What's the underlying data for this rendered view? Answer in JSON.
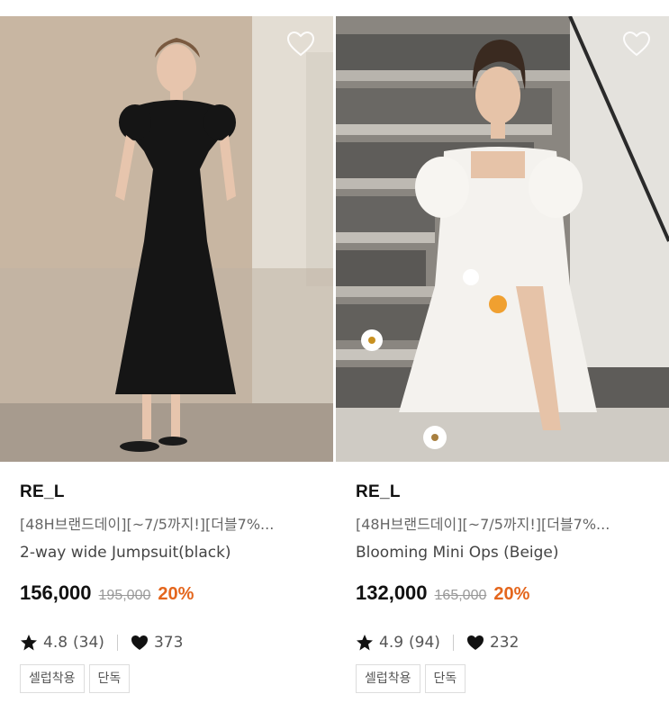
{
  "products": [
    {
      "brand": "RE_L",
      "promo": "[48H브랜드데이][~7/5까지!][더블7%...",
      "name": "2-way wide Jumpsuit(black)",
      "price": "156,000",
      "original_price": "195,000",
      "discount": "20%",
      "rating": "4.8",
      "review_count": "(34)",
      "likes": "373",
      "tags": [
        "셀럽착용",
        "단독"
      ],
      "icons": {
        "wishlist": "heart-outline-icon",
        "rating": "star-icon",
        "likes": "heart-icon"
      }
    },
    {
      "brand": "RE_L",
      "promo": "[48H브랜드데이][~7/5까지!][더블7%...",
      "name": "Blooming Mini Ops (Beige)",
      "price": "132,000",
      "original_price": "165,000",
      "discount": "20%",
      "rating": "4.9",
      "review_count": "(94)",
      "likes": "232",
      "tags": [
        "셀럽착용",
        "단독"
      ],
      "icons": {
        "wishlist": "heart-outline-icon",
        "rating": "star-icon",
        "likes": "heart-icon"
      }
    }
  ],
  "colors": {
    "discount": "#e4661d",
    "text": "#111111",
    "muted": "#999999"
  }
}
